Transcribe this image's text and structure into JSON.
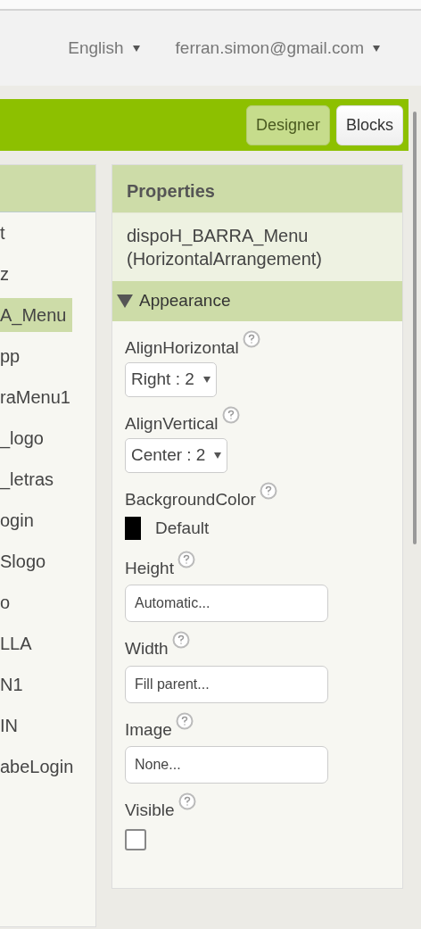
{
  "header": {
    "language": "English",
    "account": "ferran.simon@gmail.com"
  },
  "toolbar": {
    "buttons": [
      {
        "label": "Designer",
        "selected": true
      },
      {
        "label": "Blocks",
        "selected": false
      }
    ]
  },
  "components": {
    "items": [
      {
        "label": "t",
        "selected": false
      },
      {
        "label": "z",
        "selected": false
      },
      {
        "label": "A_Menu",
        "selected": true
      },
      {
        "label": "pp",
        "selected": false
      },
      {
        "label": "raMenu1",
        "selected": false
      },
      {
        "label": "_logo",
        "selected": false
      },
      {
        "label": "_letras",
        "selected": false
      },
      {
        "label": "ogin",
        "selected": false
      },
      {
        "label": "Slogo",
        "selected": false
      },
      {
        "label": "o",
        "selected": false
      },
      {
        "label": "LLA",
        "selected": false
      },
      {
        "label": "N1",
        "selected": false
      },
      {
        "label": "IN",
        "selected": false
      },
      {
        "label": "abeLogin",
        "selected": false
      }
    ]
  },
  "properties": {
    "title": "Properties",
    "component_name": "dispoH_BARRA_Menu",
    "component_type": "(HorizontalArrangement)",
    "section": {
      "label": "Appearance",
      "expanded": true
    },
    "items": [
      {
        "kind": "dropdown",
        "label": "AlignHorizontal",
        "value": "Right : 2"
      },
      {
        "kind": "dropdown",
        "label": "AlignVertical",
        "value": "Center : 2"
      },
      {
        "kind": "color",
        "label": "BackgroundColor",
        "value": "Default",
        "color": "#000000"
      },
      {
        "kind": "field",
        "label": "Height",
        "value": "Automatic..."
      },
      {
        "kind": "field",
        "label": "Width",
        "value": "Fill parent..."
      },
      {
        "kind": "field",
        "label": "Image",
        "value": "None..."
      },
      {
        "kind": "checkbox",
        "label": "Visible",
        "checked": false
      }
    ]
  }
}
